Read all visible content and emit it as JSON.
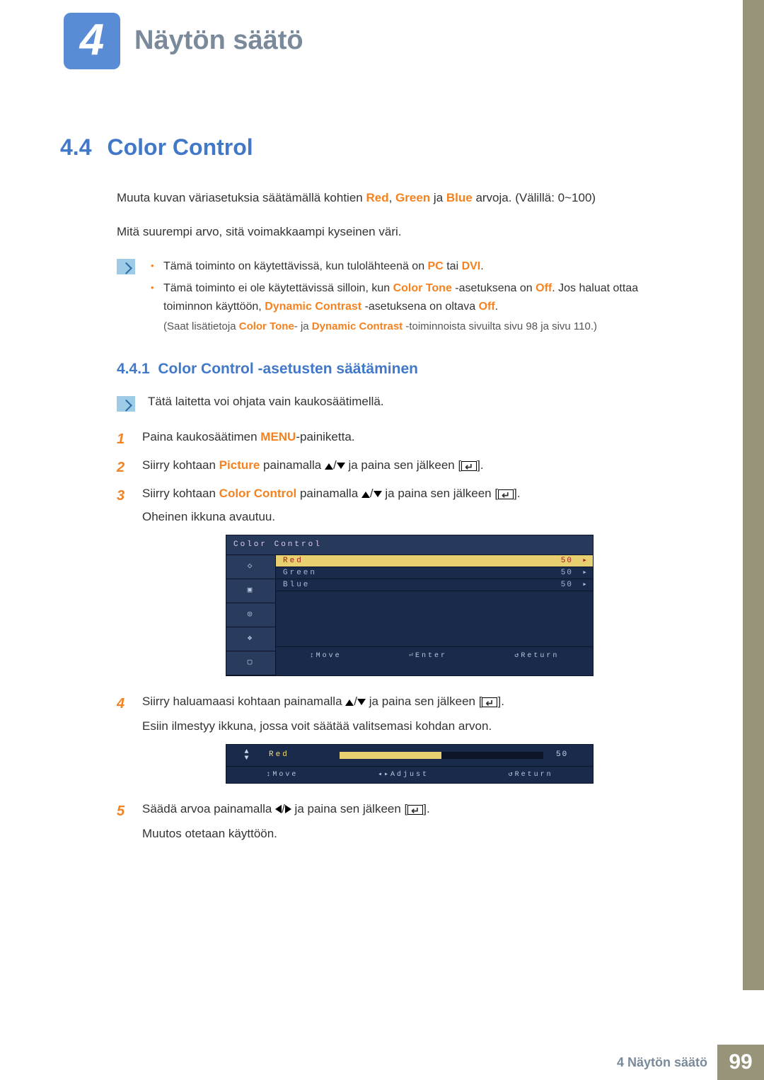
{
  "chapter": {
    "number": "4",
    "title": "Näytön säätö"
  },
  "section": {
    "number": "4.4",
    "title": "Color Control"
  },
  "intro": {
    "p1a": "Muuta kuvan väriasetuksia säätämällä kohtien ",
    "red": "Red",
    "comma": ", ",
    "green": "Green",
    "ja": " ja ",
    "blue": "Blue",
    "p1b": " arvoja. (Välillä: 0~100)",
    "p2": "Mitä suurempi arvo, sitä voimakkaampi kyseinen väri."
  },
  "note1": {
    "b1a": "Tämä toiminto on käytettävissä, kun tulolähteenä on ",
    "pc": "PC",
    "tai": " tai ",
    "dvi": "DVI",
    "b1b": ".",
    "b2a": "Tämä toiminto ei ole käytettävissä silloin, kun ",
    "ct": "Color Tone",
    "b2b": " -asetuksena on ",
    "off1": "Off",
    "b2c": ". Jos haluat ottaa toiminnon käyttöön, ",
    "dc": "Dynamic Contrast",
    "b2d": " -asetuksena on oltava ",
    "off2": "Off",
    "b2e": ".",
    "b3a": "(Saat lisätietoja ",
    "ct2": "Color Tone",
    "b3b": "- ja ",
    "dc2": "Dynamic Contrast",
    "b3c": " -toiminnoista sivuilta sivu 98 ja sivu 110.)"
  },
  "subsection": {
    "number": "4.4.1",
    "title": "Color Control -asetusten säätäminen"
  },
  "note2": "Tätä laitetta voi ohjata vain kaukosäätimellä.",
  "steps": {
    "s1a": "Paina kaukosäätimen ",
    "menu": "MENU",
    "s1b": "-painiketta.",
    "s2a": "Siirry kohtaan ",
    "picture": "Picture",
    "s2b": " painamalla ",
    "s2c": " ja paina sen jälkeen [",
    "s2d": "].",
    "s3a": "Siirry kohtaan ",
    "cc": "Color Control",
    "s3b": " painamalla ",
    "s3c": " ja paina sen jälkeen [",
    "s3d": "].",
    "s3e": "Oheinen ikkuna avautuu.",
    "s4a": "Siirry haluamaasi kohtaan painamalla ",
    "s4b": " ja paina sen jälkeen [",
    "s4c": "].",
    "s4d": "Esiin ilmestyy ikkuna, jossa voit säätää valitsemasi kohdan arvon.",
    "s5a": "Säädä arvoa painamalla ",
    "s5b": " ja paina sen jälkeen [",
    "s5c": "].",
    "s5d": "Muutos otetaan käyttöön."
  },
  "osd1": {
    "title": "Color Control",
    "rows": [
      {
        "label": "Red",
        "value": "50"
      },
      {
        "label": "Green",
        "value": "50"
      },
      {
        "label": "Blue",
        "value": "50"
      }
    ],
    "foot": {
      "move": "Move",
      "enter": "Enter",
      "return": "Return"
    }
  },
  "osd2": {
    "label": "Red",
    "value": "50",
    "percent": 50,
    "foot": {
      "move": "Move",
      "adjust": "Adjust",
      "return": "Return"
    }
  },
  "footer": {
    "label": "4 Näytön säätö",
    "page": "99"
  }
}
